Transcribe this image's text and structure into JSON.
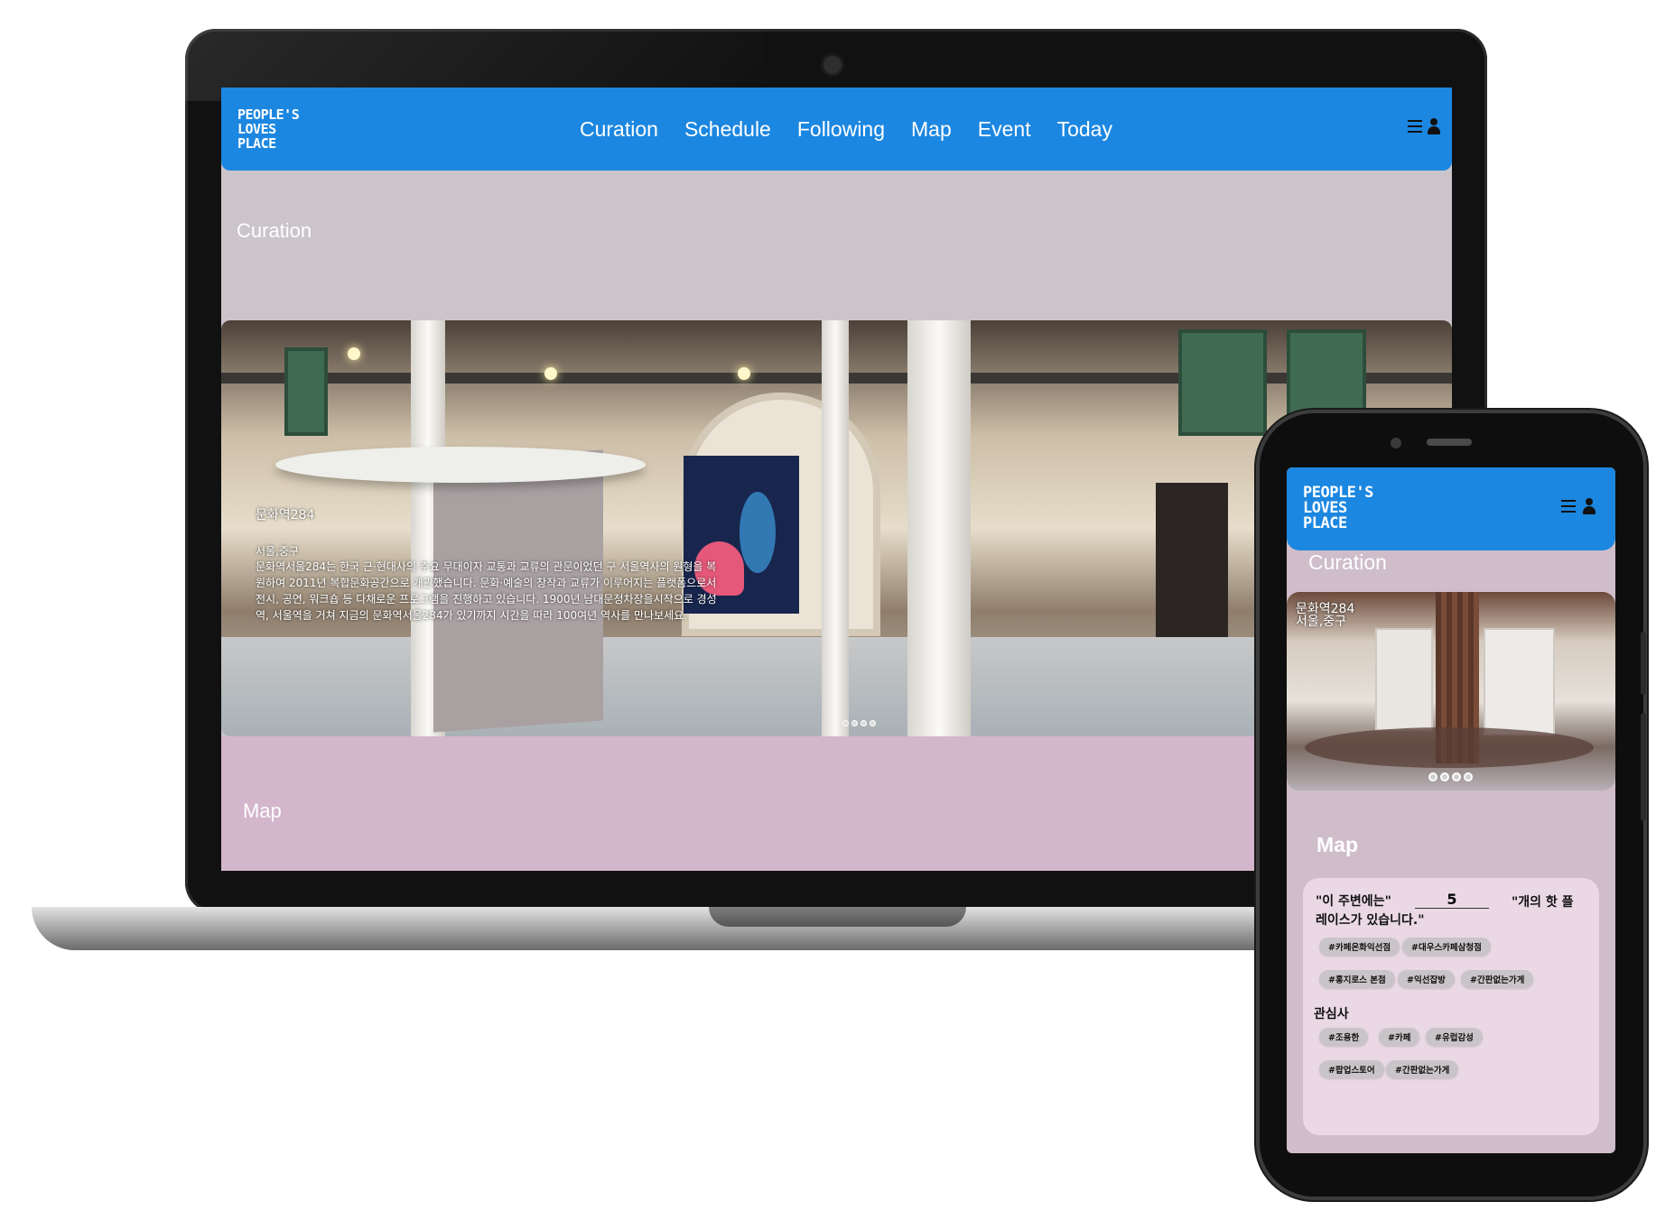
{
  "brand": {
    "logo_lines": [
      "PEOPLE'S",
      "LOVES",
      "PLACE"
    ]
  },
  "desktop": {
    "nav": {
      "links": [
        "Curation",
        "Schedule",
        "Following",
        "Map",
        "Event",
        "Today"
      ]
    },
    "curation": {
      "title": "Curation",
      "place_name": "문화역284",
      "location": "서울,중구",
      "description": "문화역서울284는 한국 근·현대사의 주요 무대이자 교통과 교류의 관문이었던 구 서울역사의 원형을 복원하여 2011년 복합문화공간으로 개관했습니다. 문화·예술의 창작과 교류가 이루어지는 플랫폼으로서 전시, 공연, 워크숍 등 다채로운 프로그램을 진행하고 있습니다. 1900년 남대문정차장을시작으로 경성역, 서울역을 거쳐 지금의 문화역서울284가 있기까지 시간을 따라 100여년 역사를 만나보세요.",
      "carousel_dots": 4
    },
    "map": {
      "title": "Map"
    }
  },
  "mobile": {
    "curation": {
      "title": "Curation",
      "place_name": "문화역284",
      "location": "서울,중구",
      "carousel_dots": 4
    },
    "map": {
      "title": "Map",
      "sentence_prefix": "\"이 주변에는\"",
      "count": "5",
      "sentence_suffix": "\"개의 핫 플",
      "sentence_end": "레이스가 있습니다.\"",
      "hot_tags": [
        "#카페온화익선점",
        "#대우스카페삼청점",
        "#홍지로스 본점",
        "#익선잡방",
        "#간판없는가게"
      ],
      "interest_label": "관심사",
      "interest_tags": [
        "#조용한",
        "#카페",
        "#유럽감성",
        "#팝업스토어",
        "#간판없는가게"
      ]
    }
  },
  "colors": {
    "nav_blue": "#1c87e0",
    "page_gray": "#cbc4cb",
    "map_pink": "#d3b6cb",
    "card": "#ead9e4"
  }
}
